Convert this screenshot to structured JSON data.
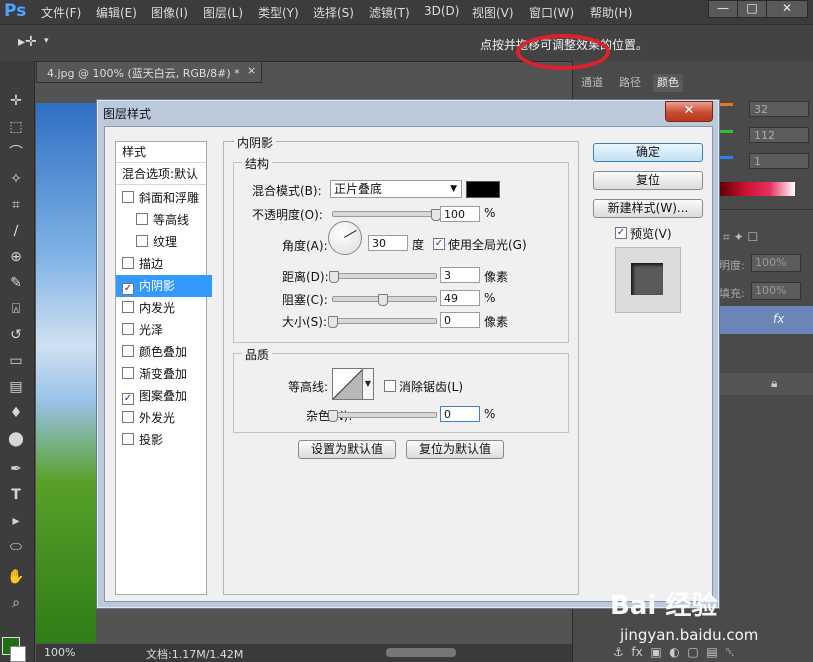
{
  "app": {
    "logo": "Ps"
  },
  "menu": [
    "文件(F)",
    "编辑(E)",
    "图像(I)",
    "图层(L)",
    "类型(Y)",
    "选择(S)",
    "滤镜(T)",
    "3D(D)",
    "视图(V)",
    "窗口(W)",
    "帮助(H)"
  ],
  "window_controls": {
    "minimize": "—",
    "restore": "□",
    "close": "✕"
  },
  "options_bar": {
    "hint": "点按并拖移可调整效果的位置。"
  },
  "document": {
    "tab_title": "4.jpg @ 100% (蓝天白云, RGB/8#) *",
    "tab_close": "×"
  },
  "status": {
    "zoom": "100%",
    "doc_info": "文档:1.17M/1.42M"
  },
  "right_panel": {
    "tabs": [
      "通道",
      "路径",
      "颜色"
    ],
    "color_values": [
      "32",
      "112",
      "1"
    ],
    "opacity_label": "明度:",
    "opacity_value": "100%",
    "fill_label": "填充:",
    "fill_value": "100%",
    "fx": "fx"
  },
  "dialog": {
    "title": "图层样式",
    "close": "✕",
    "style_list": {
      "header": "样式",
      "blend_options": "混合选项:默认",
      "items": [
        {
          "label": "斜面和浮雕",
          "checked": false,
          "indent": false,
          "selected": false
        },
        {
          "label": "等高线",
          "checked": false,
          "indent": true,
          "selected": false
        },
        {
          "label": "纹理",
          "checked": false,
          "indent": true,
          "selected": false
        },
        {
          "label": "描边",
          "checked": false,
          "indent": false,
          "selected": false
        },
        {
          "label": "内阴影",
          "checked": true,
          "indent": false,
          "selected": true
        },
        {
          "label": "内发光",
          "checked": false,
          "indent": false,
          "selected": false
        },
        {
          "label": "光泽",
          "checked": false,
          "indent": false,
          "selected": false
        },
        {
          "label": "颜色叠加",
          "checked": false,
          "indent": false,
          "selected": false
        },
        {
          "label": "渐变叠加",
          "checked": false,
          "indent": false,
          "selected": false
        },
        {
          "label": "图案叠加",
          "checked": true,
          "indent": false,
          "selected": false
        },
        {
          "label": "外发光",
          "checked": false,
          "indent": false,
          "selected": false
        },
        {
          "label": "投影",
          "checked": false,
          "indent": false,
          "selected": false
        }
      ]
    },
    "inner_shadow": {
      "section_title": "内阴影",
      "structure_title": "结构",
      "blend_mode_label": "混合模式(B):",
      "blend_mode_value": "正片叠底",
      "shadow_color": "#000000",
      "opacity_label": "不透明度(O):",
      "opacity_value": "100",
      "opacity_fraction": 1.0,
      "percent": "%",
      "angle_label": "角度(A):",
      "angle_value": "30",
      "angle_unit": "度",
      "global_light_label": "使用全局光(G)",
      "global_light_checked": true,
      "distance_label": "距离(D):",
      "distance_value": "3",
      "distance_fraction": 0.01,
      "pixel_unit": "像素",
      "choke_label": "阻塞(C):",
      "choke_value": "49",
      "choke_fraction": 0.49,
      "size_label": "大小(S):",
      "size_value": "0",
      "size_fraction": 0.0,
      "quality_title": "品质",
      "contour_label": "等高线:",
      "anti_alias_label": "消除锯齿(L)",
      "anti_alias_checked": false,
      "noise_label": "杂色(N):",
      "noise_value": "0",
      "noise_fraction": 0.0,
      "set_default_label": "设置为默认值",
      "reset_default_label": "复位为默认值"
    },
    "buttons": {
      "ok": "确定",
      "reset": "复位",
      "new_style": "新建样式(W)...",
      "preview_label": "预览(V)",
      "preview_checked": true
    }
  },
  "colors": {
    "selection_blue": "#3399ff",
    "highlight_red": "#e0202a"
  },
  "watermark": {
    "logo": "Bai  经验",
    "url": "jingyan.baidu.com"
  }
}
